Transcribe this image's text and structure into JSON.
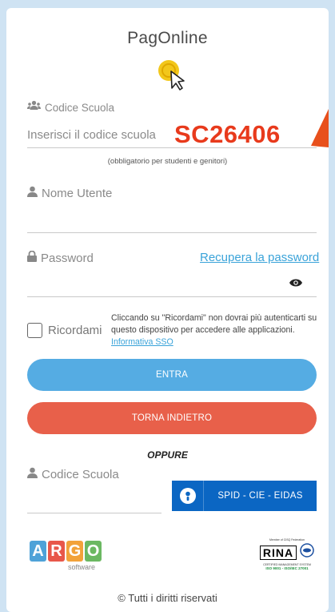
{
  "app_title": "PagOnline",
  "school": {
    "label": "Codice Scuola",
    "placeholder": "Inserisci il codice scuola",
    "value_overlay": "SC26406",
    "hint": "(obbligatorio per studenti e genitori)"
  },
  "username": {
    "label": "Nome Utente"
  },
  "password": {
    "label": "Password",
    "recover_link": "Recupera la password"
  },
  "remember": {
    "label": "Ricordami",
    "info": "Cliccando su \"Ricordami\" non dovrai più autenticarti su questo dispositivo per accedere alle applicazioni.",
    "info_link": "Informativa SSO"
  },
  "buttons": {
    "login": "ENTRA",
    "back": "TORNA INDIETRO"
  },
  "or_label": "OPPURE",
  "spid": {
    "school_label": "Codice Scuola",
    "button": "SPID - CIE - EIDAS"
  },
  "footer": {
    "argo_letters": [
      "A",
      "R",
      "G",
      "O"
    ],
    "argo_sub": "software",
    "risa_top": "Member of CISQ Federation",
    "risa_text": "RINA",
    "risa_sub": "CERTIFIED MANAGEMENT SYSTEM",
    "risa_iso": "ISO 9001 - ISO/IEC 27001",
    "copyright": "© Tutti i diritti riservati"
  },
  "colors": {
    "primary_blue": "#55ace3",
    "danger_red": "#e8604a",
    "overlay_red": "#e83a1c",
    "spid_blue": "#0b66c3",
    "argo": [
      "#4fa2d8",
      "#e8574a",
      "#f2a23a",
      "#6bb862"
    ]
  }
}
